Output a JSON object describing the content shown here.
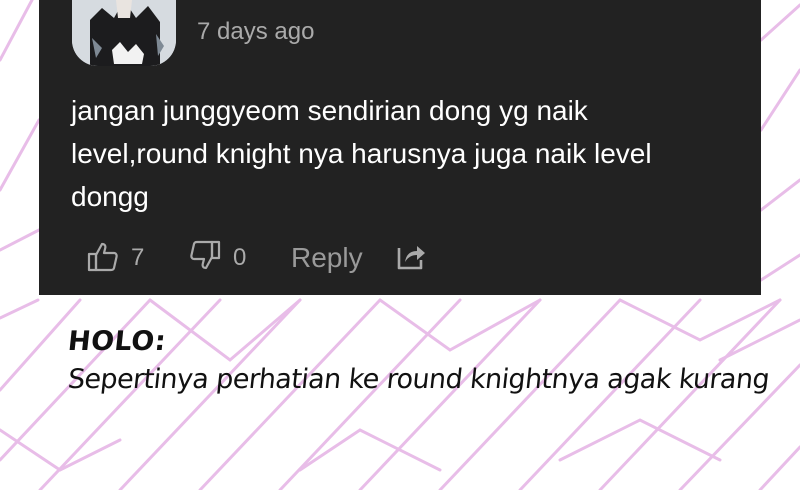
{
  "comment": {
    "time_ago": "7 days ago",
    "text": "jangan junggyeom sendirian dong yg naik level,round knight nya harusnya juga naik level dongg",
    "likes": "7",
    "dislikes": "0",
    "reply_label": "Reply"
  },
  "icons": {
    "like": "thumbs-up-icon",
    "dislike": "thumbs-down-icon",
    "share": "share-icon"
  },
  "caption": {
    "speaker": "HOLO:",
    "text": "Sepertinya perhatian ke round knightnya agak kurang"
  },
  "colors": {
    "card_background": "#222222",
    "pattern_lines": "#e8bde8",
    "comment_text": "#ffffff",
    "meta_text": "#aaaaaa"
  }
}
